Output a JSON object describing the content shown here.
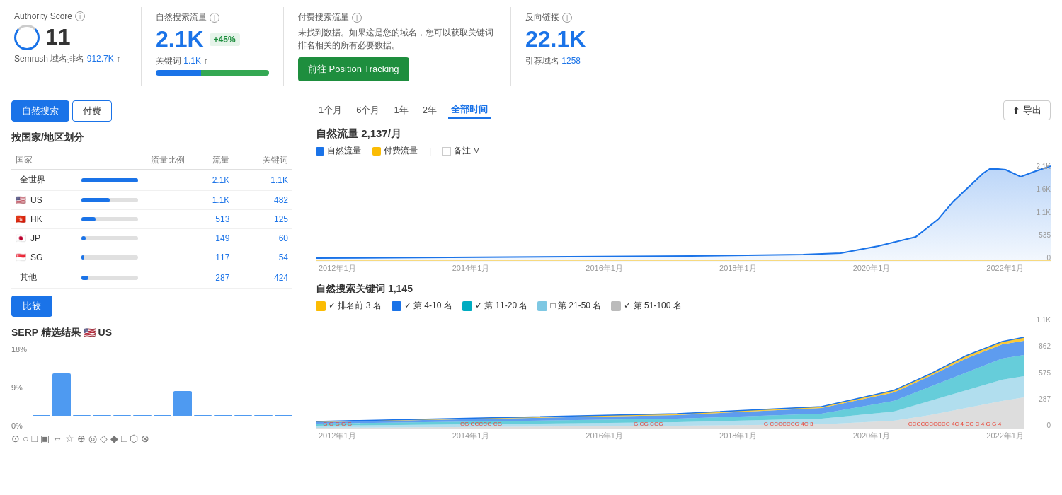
{
  "metrics": {
    "authority": {
      "label": "Authority Score",
      "value": "11",
      "sub": "Semrush 域名排名",
      "sub_value": "912.7K",
      "sub_arrow": "↑"
    },
    "organic": {
      "label": "自然搜索流量",
      "value": "2.1K",
      "badge": "+45%",
      "keyword_label": "关键词",
      "keyword_value": "1.1K",
      "keyword_arrow": "↑"
    },
    "paid": {
      "label": "付费搜索流量",
      "desc": "未找到数据。如果这是您的域名，您可以获取关键词排名相关的所有必要数据。",
      "btn": "前往 Position Tracking"
    },
    "backlinks": {
      "label": "反向链接",
      "value": "22.1K",
      "sub_label": "引荐域名",
      "sub_value": "1258"
    }
  },
  "tabs": {
    "organic": "自然搜索",
    "paid": "付费"
  },
  "country_section": {
    "title": "按国家/地区划分",
    "headers": [
      "国家",
      "流量比例",
      "流量",
      "关键词"
    ],
    "rows": [
      {
        "name": "全世界",
        "flag": "",
        "pct": "100%",
        "pct_width": 80,
        "traffic": "2.1K",
        "keywords": "1.1K"
      },
      {
        "name": "US",
        "flag": "🇺🇸",
        "pct": "50%",
        "pct_width": 40,
        "traffic": "1.1K",
        "keywords": "482"
      },
      {
        "name": "HK",
        "flag": "🇭🇰",
        "pct": "24%",
        "pct_width": 20,
        "traffic": "513",
        "keywords": "125"
      },
      {
        "name": "JP",
        "flag": "🇯🇵",
        "pct": "7%",
        "pct_width": 6,
        "traffic": "149",
        "keywords": "60"
      },
      {
        "name": "SG",
        "flag": "🇸🇬",
        "pct": "5.5%",
        "pct_width": 4,
        "traffic": "117",
        "keywords": "54"
      },
      {
        "name": "其他",
        "flag": "",
        "pct": "13%",
        "pct_width": 10,
        "traffic": "287",
        "keywords": "424"
      }
    ]
  },
  "compare_btn": "比较",
  "serp": {
    "title": "SERP 精选结果",
    "flag": "🇺🇸",
    "country": "US",
    "y_labels": [
      "18%",
      "9%",
      "0%"
    ],
    "bars": [
      0,
      60,
      0,
      0,
      0,
      0,
      0,
      35,
      0,
      0,
      0,
      0,
      0
    ],
    "icons": [
      "⊙",
      "○",
      "□",
      "▣",
      "↔",
      "☆",
      "⊕",
      "◎",
      "◇",
      "◆",
      "□",
      "⬡",
      "⊗"
    ]
  },
  "time_filters": [
    "1个月",
    "6个月",
    "1年",
    "2年",
    "全部时间"
  ],
  "active_time": "全部时间",
  "export_btn": "导出",
  "traffic_section": {
    "title": "自然流量",
    "value": "2,137/月",
    "legend": [
      {
        "label": "自然流量",
        "color": "blue"
      },
      {
        "label": "付费流量",
        "color": "orange"
      },
      {
        "label": "备注",
        "type": "checkbox"
      }
    ],
    "y_labels": [
      "2.1K",
      "1.6K",
      "1.1K",
      "535",
      "0"
    ],
    "x_labels": [
      "2012年1月",
      "2014年1月",
      "2016年1月",
      "2018年1月",
      "2020年1月",
      "2022年1月"
    ]
  },
  "keywords_section": {
    "title": "自然搜索关键词",
    "value": "1,145",
    "legend": [
      {
        "label": "排名前 3 名",
        "color": "yellow"
      },
      {
        "label": "第 4-10 名",
        "color": "blue"
      },
      {
        "label": "第 11-20 名",
        "color": "teal"
      },
      {
        "label": "第 21-50 名",
        "color": "lightblue"
      },
      {
        "label": "第 51-100 名",
        "color": "gray"
      }
    ],
    "y_labels": [
      "1.1K",
      "862",
      "575",
      "287",
      "0"
    ],
    "x_labels": [
      "2012年1月",
      "2014年1月",
      "2016年1月",
      "2018年1月",
      "2020年1月",
      "2022年1月"
    ]
  }
}
